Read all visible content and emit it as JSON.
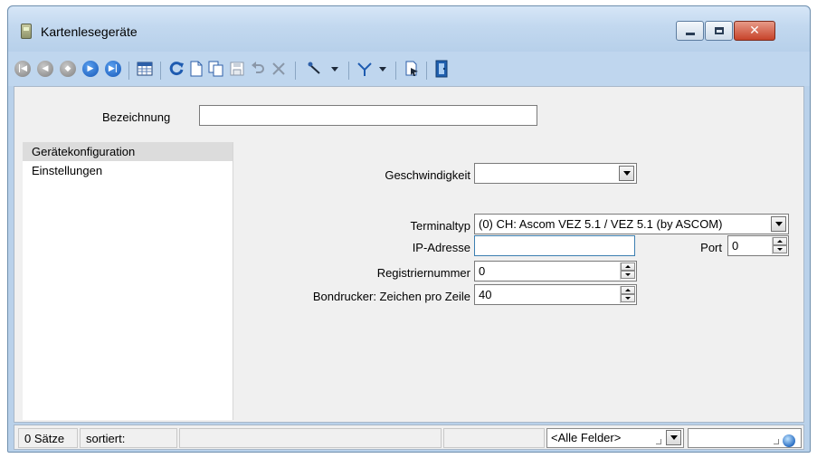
{
  "window": {
    "title": "Kartenlesegeräte",
    "buttons": {
      "minimize": "minimize",
      "maximize": "maximize",
      "close": "✕"
    }
  },
  "toolbar": {
    "icons": [
      "first-record-icon",
      "previous-record-icon",
      "search-record-icon",
      "next-record-icon",
      "last-record-icon",
      "table-view-icon",
      "refresh-icon",
      "new-document-icon",
      "copy-icon",
      "save-icon",
      "undo-icon",
      "delete-icon",
      "pin-icon",
      "filter-icon",
      "export-icon",
      "exit-icon"
    ]
  },
  "header": {
    "bezeichnung_label": "Bezeichnung",
    "bezeichnung_value": ""
  },
  "sidebar": {
    "items": [
      {
        "label": "Gerätekonfiguration",
        "selected": true
      },
      {
        "label": "Einstellungen",
        "selected": false
      }
    ]
  },
  "form": {
    "geschwindigkeit_label": "Geschwindigkeit",
    "geschwindigkeit_value": "",
    "terminaltyp_label": "Terminaltyp",
    "terminaltyp_value": "(0) CH: Ascom VEZ 5.1 / VEZ 5.1 (by ASCOM)",
    "ip_label": "IP-Adresse",
    "ip_value": "",
    "port_label": "Port",
    "port_value": "0",
    "registriernummer_label": "Registriernummer",
    "registriernummer_value": "0",
    "bondrucker_label": "Bondrucker: Zeichen pro Zeile",
    "bondrucker_value": "40"
  },
  "statusbar": {
    "records": "0 Sätze",
    "sorted": "sortiert:",
    "field_filter": "<Alle Felder>",
    "search_value": ""
  },
  "colors": {
    "frame": "#b9d1ea",
    "toolbar": "#bfd6ee",
    "nav_blue": "#1557b8",
    "close_red": "#c7432a",
    "selected_row": "#dcdcdc"
  }
}
